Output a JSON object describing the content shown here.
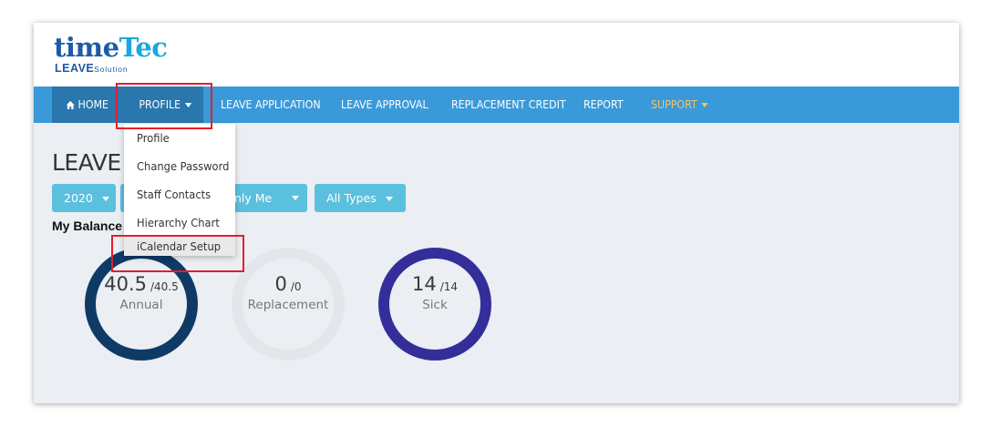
{
  "logo": {
    "main_part1": "time",
    "main_part2": "Tec",
    "sub_part1": "LEAVE",
    "sub_part2": "Solution"
  },
  "nav": {
    "home": "HOME",
    "profile": "PROFILE",
    "leave_application": "LEAVE APPLICATION",
    "leave_approval": "LEAVE APPROVAL",
    "replacement_credit": "REPLACEMENT CREDIT",
    "report": "REPORT",
    "support": "SUPPORT"
  },
  "profile_menu": {
    "items": [
      "Profile",
      "Change Password",
      "Staff Contacts",
      "Hierarchy Chart",
      "iCalendar Setup"
    ],
    "active_index": 4
  },
  "page": {
    "title_visible": "LEAVE (",
    "subtitle_visible": "My Balance"
  },
  "filters": {
    "year": "2020",
    "scope_visible": "nly Me",
    "type": "All Types"
  },
  "balances": [
    {
      "value": "40.5",
      "total": "/40.5",
      "label": "Annual",
      "ring_color": "#0e3a66",
      "fraction": 1.0
    },
    {
      "value": "0",
      "total": "/0",
      "label": "Replacement",
      "ring_color": "#e3e6ea",
      "fraction": 0
    },
    {
      "value": "14",
      "total": "/14",
      "label": "Sick",
      "ring_color": "#332e9a",
      "fraction": 1.0
    }
  ],
  "colors": {
    "navbar": "#3a9ad9",
    "navbar_active": "#2a77ad",
    "support": "#f5c26b",
    "filter_button": "#5bc0de",
    "highlight": "#e0202e"
  }
}
